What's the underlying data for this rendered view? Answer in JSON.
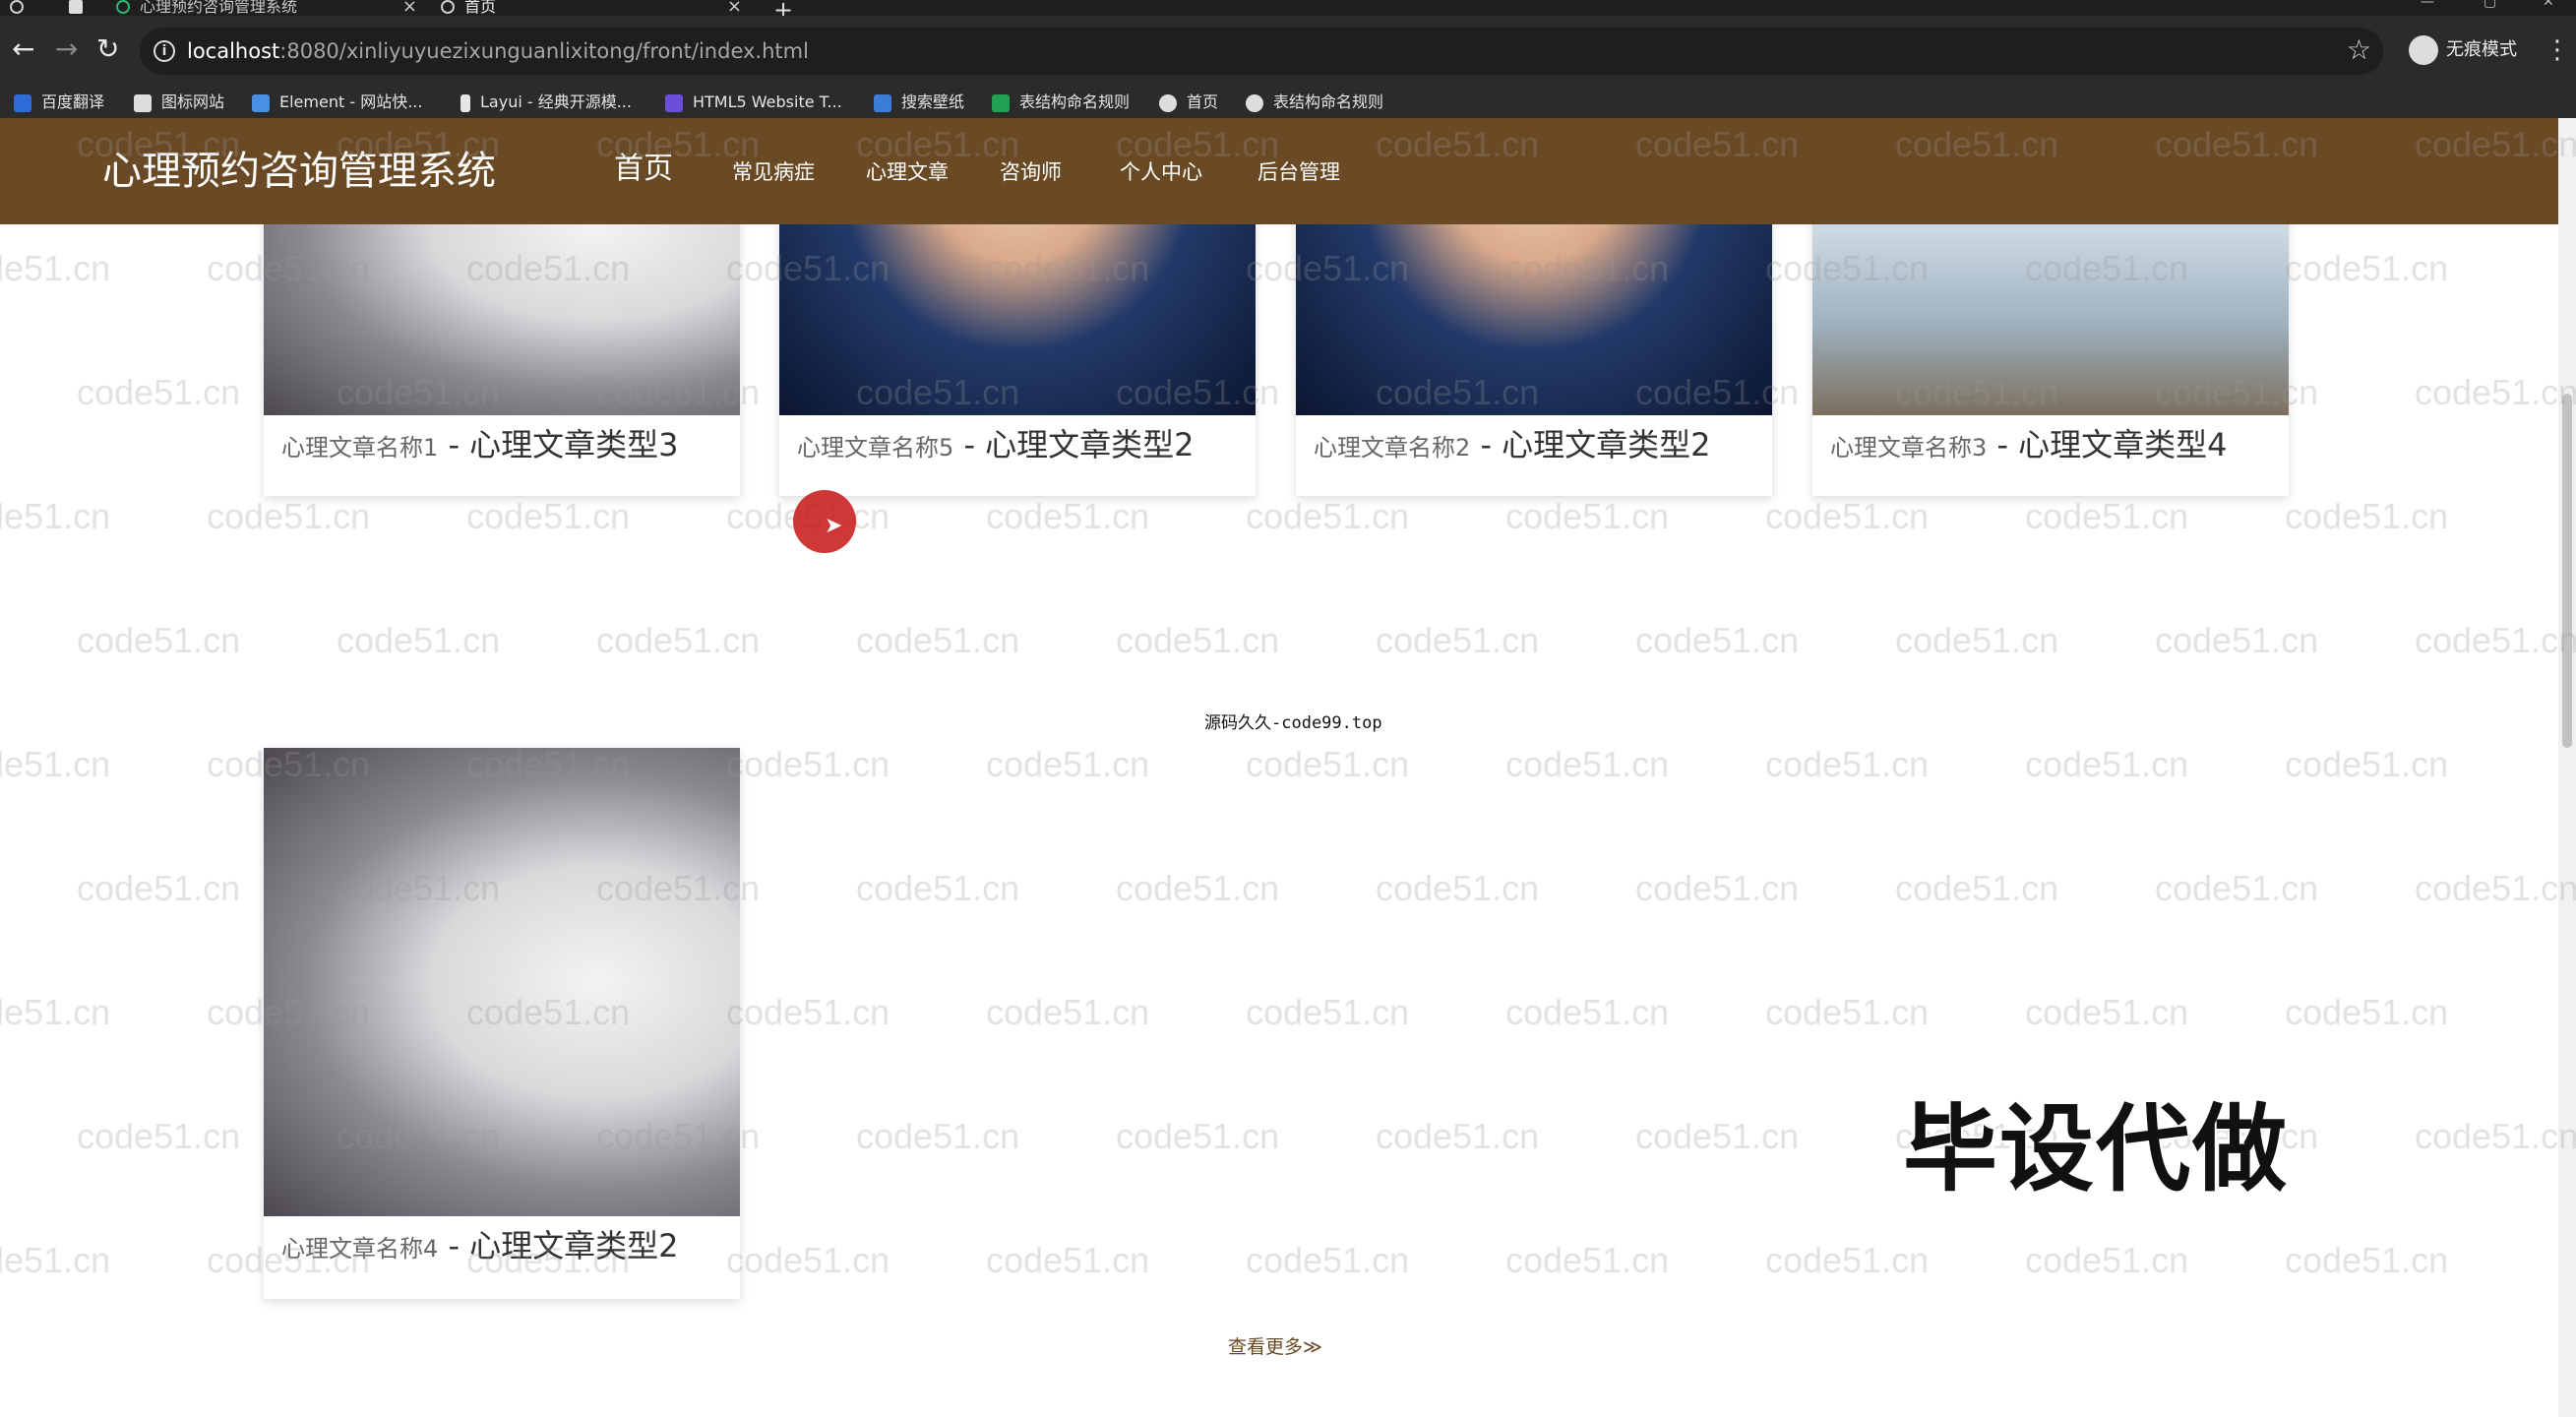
{
  "browser": {
    "tabs": [
      {
        "label": "心理预约咨询管理系统",
        "active": false
      },
      {
        "label": "首页",
        "active": true
      }
    ],
    "url_host": "localhost",
    "url_path": ":8080/xinliyuyuezixunguanlixitong/front/index.html",
    "profile_label": "无痕模式",
    "bookmarks": [
      {
        "label": "百度翻译",
        "color": "#2f6bd8"
      },
      {
        "label": "图标网站",
        "color": "#dddddd"
      },
      {
        "label": "Element - 网站快...",
        "color": "#4a90e2"
      },
      {
        "label": "Layui - 经典开源模...",
        "color": "#e6e6e6"
      },
      {
        "label": "HTML5 Website T...",
        "color": "#6b4fd8"
      },
      {
        "label": "搜索壁纸",
        "color": "#3c7bd6"
      },
      {
        "label": "表结构命名规则",
        "color": "#22a052"
      },
      {
        "label": "首页",
        "color": "#dddddd"
      },
      {
        "label": "表结构命名规则",
        "color": "#dddddd"
      }
    ]
  },
  "site": {
    "title": "心理预约咨询管理系统",
    "nav": [
      {
        "label": "首页",
        "active": true
      },
      {
        "label": "常见病症",
        "active": false
      },
      {
        "label": "心理文章",
        "active": false
      },
      {
        "label": "咨询师",
        "active": false
      },
      {
        "label": "个人中心",
        "active": false
      },
      {
        "label": "后台管理",
        "active": false
      }
    ],
    "brand_color": "#6a4a25"
  },
  "articles": [
    {
      "name": "心理文章名称1",
      "sep": " - ",
      "type": "心理文章类型3",
      "image": "husky-dog"
    },
    {
      "name": "心理文章名称5",
      "sep": " - ",
      "type": "心理文章类型2",
      "image": "young-man-portrait"
    },
    {
      "name": "心理文章名称2",
      "sep": " - ",
      "type": "心理文章类型2",
      "image": "young-man-portrait"
    },
    {
      "name": "心理文章名称3",
      "sep": " - ",
      "type": "心理文章类型4",
      "image": "girl-at-beach"
    },
    {
      "name": "心理文章名称4",
      "sep": " - ",
      "type": "心理文章类型2",
      "image": "husky-dog"
    }
  ],
  "overlay": {
    "center_note": "源码久久-code99.top",
    "stamp": "毕设代做",
    "watermark": "code51.cn"
  },
  "more_link": "查看更多≫"
}
